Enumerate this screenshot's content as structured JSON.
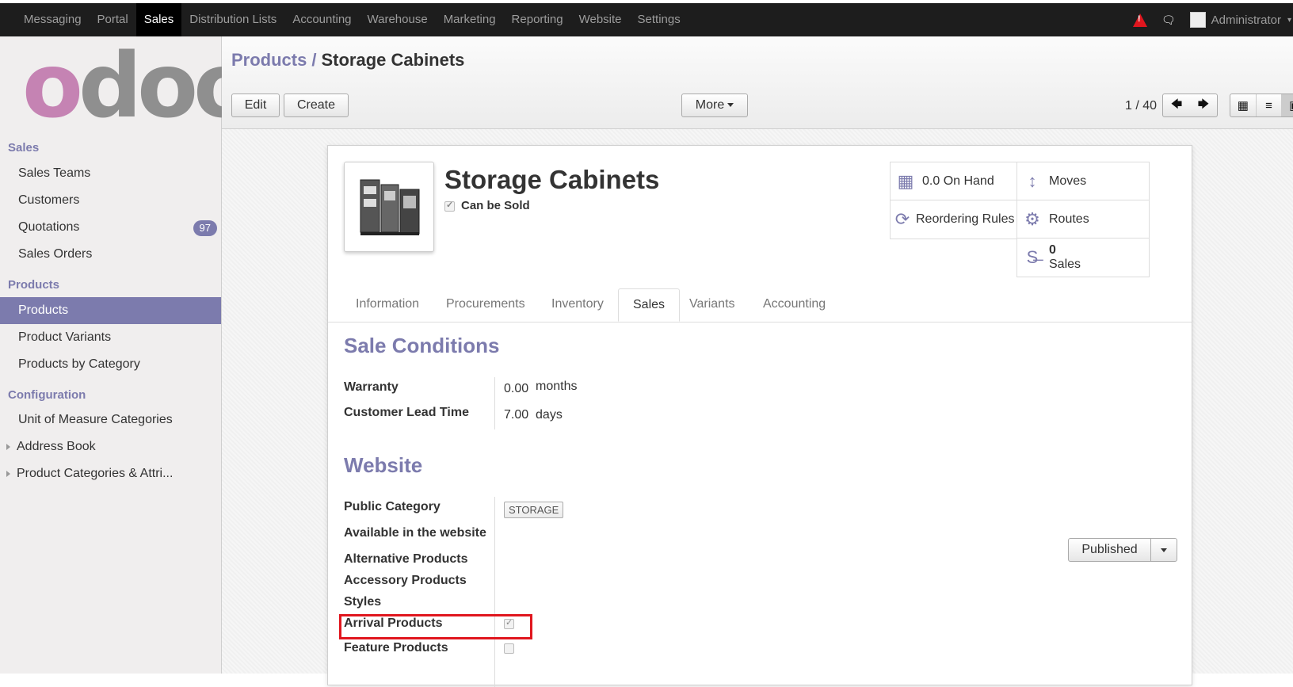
{
  "topbar": {
    "menu": [
      {
        "label": "Messaging"
      },
      {
        "label": "Portal"
      },
      {
        "label": "Sales"
      },
      {
        "label": "Distribution Lists"
      },
      {
        "label": "Accounting"
      },
      {
        "label": "Warehouse"
      },
      {
        "label": "Marketing"
      },
      {
        "label": "Reporting"
      },
      {
        "label": "Website"
      },
      {
        "label": "Settings"
      }
    ],
    "active": "Sales",
    "user": "Administrator"
  },
  "sidebar": {
    "logo": "odoo",
    "sections": [
      {
        "title": "Sales"
      },
      {
        "title": "Products"
      },
      {
        "title": "Configuration"
      }
    ],
    "items": [
      {
        "label": "Sales Teams"
      },
      {
        "label": "Customers"
      },
      {
        "label": "Quotations",
        "badge": "97"
      },
      {
        "label": "Sales Orders"
      },
      {
        "label": "Products"
      },
      {
        "label": "Product Variants"
      },
      {
        "label": "Products by Category"
      },
      {
        "label": "Unit of Measure Categories"
      },
      {
        "label": "Address Book"
      },
      {
        "label": "Product Categories & Attri..."
      }
    ]
  },
  "control_panel": {
    "breadcrumb_parent": "Products",
    "breadcrumb_sep": "/",
    "breadcrumb_current": "Storage Cabinets",
    "edit_label": "Edit",
    "create_label": "Create",
    "more_label": "More",
    "pager": "1 / 40"
  },
  "form": {
    "title": "Storage Cabinets",
    "can_be_sold": "Can be Sold",
    "stats": {
      "on_hand": "0.0 On Hand",
      "moves": "Moves",
      "reordering": "Reordering Rules",
      "routes": "Routes",
      "sales_count": "0",
      "sales_label": "Sales"
    },
    "tabs": [
      {
        "label": "Information"
      },
      {
        "label": "Procurements"
      },
      {
        "label": "Inventory"
      },
      {
        "label": "Sales"
      },
      {
        "label": "Variants"
      },
      {
        "label": "Accounting"
      }
    ],
    "sale_conditions": {
      "title": "Sale Conditions",
      "warranty_label": "Warranty",
      "warranty_value": "0.00",
      "warranty_unit": "months",
      "lead_label": "Customer Lead Time",
      "lead_value": "7.00",
      "lead_unit": "days"
    },
    "website": {
      "title": "Website",
      "public_category_label": "Public Category",
      "public_category_tag": "STORAGE",
      "available_label": "Available in the website",
      "published_label": "Published",
      "alternative_label": "Alternative Products",
      "accessory_label": "Accessory Products",
      "styles_label": "Styles",
      "arrival_label": "Arrival Products",
      "feature_label": "Feature Products"
    }
  },
  "colors": {
    "accent": "#7c7bad",
    "highlight": "#e0161e",
    "logo_pink": "#c583b3",
    "logo_grey": "#8f8f8f"
  }
}
